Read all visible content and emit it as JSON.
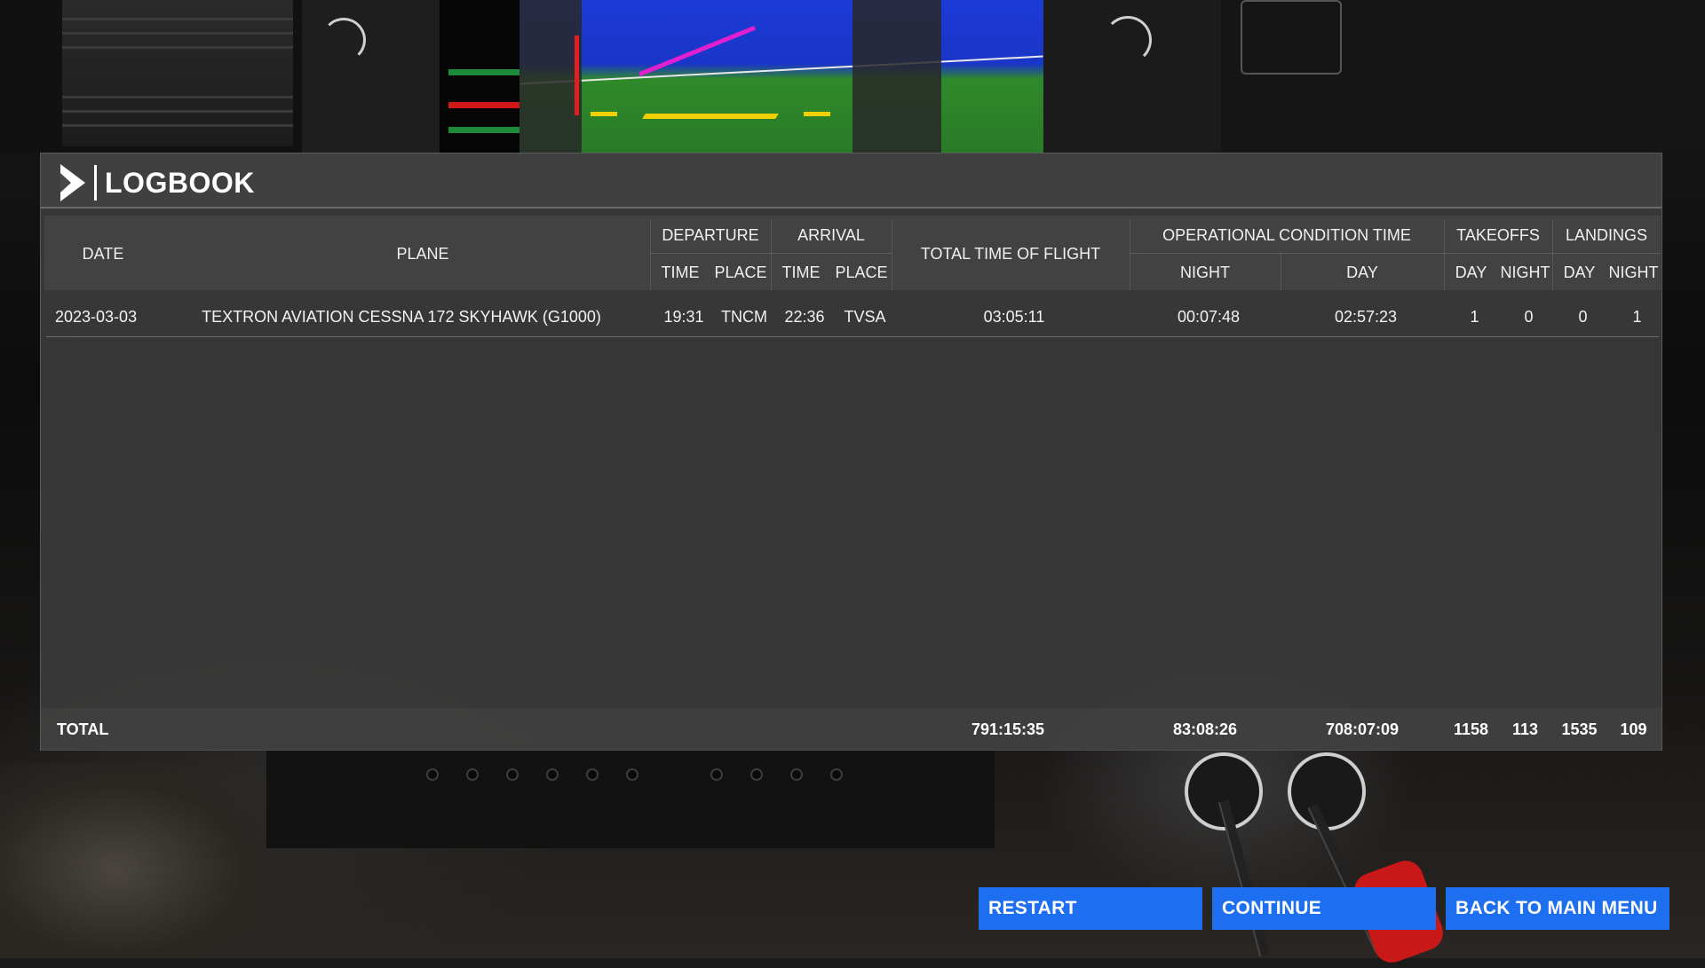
{
  "logbook": {
    "title": "LOGBOOK",
    "headers": {
      "date": "DATE",
      "plane": "PLANE",
      "departure": "DEPARTURE",
      "arrival": "ARRIVAL",
      "total_time": "TOTAL TIME OF FLIGHT",
      "operational": "OPERATIONAL CONDITION TIME",
      "takeoffs": "TAKEOFFS",
      "landings": "LANDINGS",
      "sub": {
        "dep_time": "TIME",
        "dep_place": "PLACE",
        "arr_time": "TIME",
        "arr_place": "PLACE",
        "op_night": "NIGHT",
        "op_day": "DAY",
        "to_day": "DAY",
        "to_night": "NIGHT",
        "ld_day": "DAY",
        "ld_night": "NIGHT"
      }
    },
    "rows": [
      {
        "date": "2023-03-03",
        "plane": "TEXTRON AVIATION CESSNA 172 SKYHAWK (G1000)",
        "dep_time": "19:31",
        "dep_place": "TNCM",
        "arr_time": "22:36",
        "arr_place": "TVSA",
        "total_time": "03:05:11",
        "night": "00:07:48",
        "day": "02:57:23",
        "takeoffs_day": "1",
        "takeoffs_night": "0",
        "landings_day": "0",
        "landings_night": "1"
      }
    ],
    "total": {
      "label": "TOTAL",
      "total_time": "791:15:35",
      "night": "83:08:26",
      "day": "708:07:09",
      "takeoffs_day": "1158",
      "takeoffs_night": "113",
      "landings_day": "1535",
      "landings_night": "109"
    }
  },
  "buttons": {
    "restart": "RESTART",
    "continue": "CONTINUE",
    "back": "BACK TO MAIN MENU"
  },
  "colors": {
    "button_bg": "#1d6ff0",
    "panel_bg": "#3a3a3a"
  }
}
